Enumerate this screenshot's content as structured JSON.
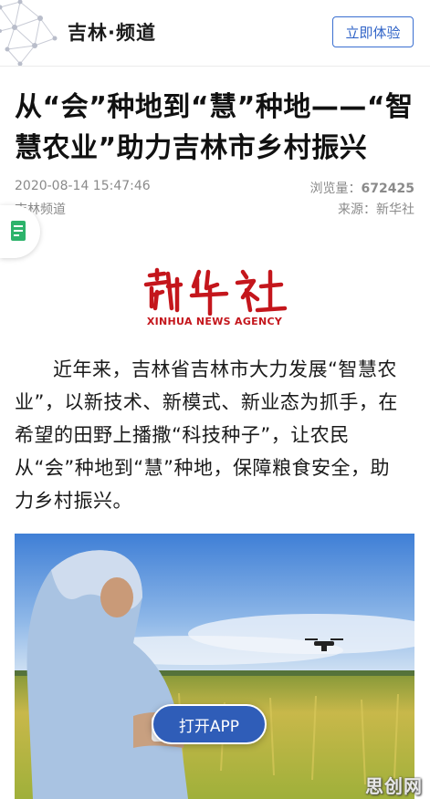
{
  "header": {
    "logo_icon": "network-logo-icon",
    "channel_title": "吉林·频道",
    "try_button_label": "立即体验"
  },
  "article": {
    "headline_line1": "从“会”种地到“慧”种地——“智",
    "headline_line2": "慧农业”助力吉林市乡村振兴",
    "date": "2020-08-14 15:47:46",
    "views_label": "浏览量：",
    "views_count": "672425",
    "channel": "吉林频道",
    "source": "来源：新华社",
    "logo_cn": "新华社",
    "logo_en": "XINHUA NEWS AGENCY",
    "body_text": "近年来，吉林省吉林市大力发展“智慧农业”，以新技术、新模式、新业态为抓手，在希望的田野上播撒“科技种子”，让农民从“会”种地到“慧”种地，保障粮食安全，助力乡村振兴。"
  },
  "floating_tab": {
    "icon": "document-icon"
  },
  "open_app_label": "打开APP",
  "watermark": "思创网",
  "colors": {
    "accent_blue": "#2f63c7",
    "xinhua_red": "#c4161c",
    "open_app_bg": "#2f5db8",
    "float_icon_green": "#2db36b"
  }
}
